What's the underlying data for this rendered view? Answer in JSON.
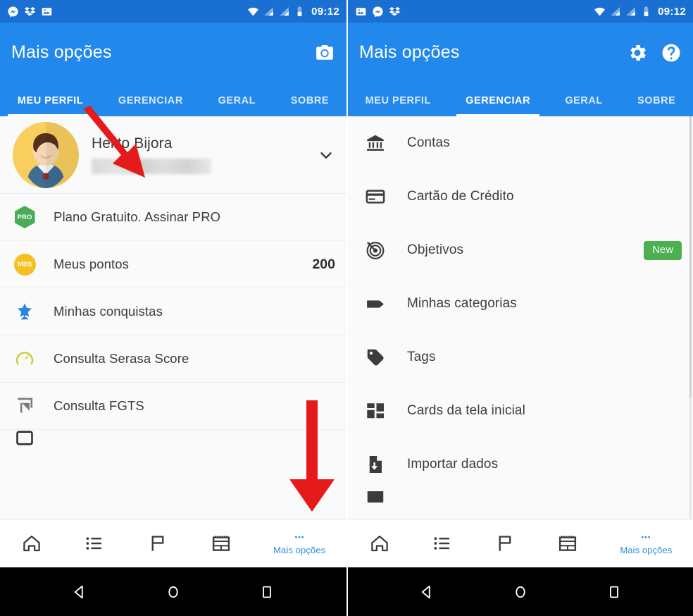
{
  "status_bar": {
    "time": "09:12",
    "left_icons_panel1": [
      "messenger-icon",
      "dropbox-icon",
      "photos-icon"
    ],
    "left_icons_panel2": [
      "photos-icon",
      "messenger-icon",
      "dropbox-icon"
    ],
    "right_icons": [
      "wifi-icon",
      "signal-icon",
      "signal-icon",
      "battery-icon"
    ]
  },
  "colors": {
    "status_bar": "#1a6fd2",
    "app_bar": "#2288ec",
    "accent": "#2a8fe0",
    "badge_new": "#4caf50",
    "pro_badge": "#47ab57",
    "points_badge": "#f5c022",
    "arrow": "#e51a1a"
  },
  "panel_left": {
    "app_bar": {
      "title": "Mais opções",
      "actions": [
        {
          "name": "camera-icon",
          "label": "Câmera"
        }
      ]
    },
    "tabs": [
      {
        "label": "MEU PERFIL",
        "active": true
      },
      {
        "label": "GERENCIAR",
        "active": false
      },
      {
        "label": "GERAL",
        "active": false
      },
      {
        "label": "SOBRE",
        "active": false
      }
    ],
    "profile": {
      "name": "Helito Bijora",
      "email_masked": "",
      "avatar": "user-avatar",
      "expand": "chevron-down-icon"
    },
    "items": [
      {
        "icon": "pro-hex-badge",
        "icon_text": "PRO",
        "label": "Plano Gratuito. Assinar PRO",
        "value": ""
      },
      {
        "icon": "mbs-circle-badge",
        "icon_text": "MB$",
        "label": "Meus pontos",
        "value": "200"
      },
      {
        "icon": "trophy-star-icon",
        "icon_text": "",
        "label": "Minhas conquistas",
        "value": ""
      },
      {
        "icon": "speedometer-icon",
        "icon_text": "",
        "label": "Consulta Serasa Score",
        "value": ""
      },
      {
        "icon": "flag-corner-icon",
        "icon_text": "",
        "label": "Consulta FGTS",
        "value": ""
      }
    ]
  },
  "panel_right": {
    "app_bar": {
      "title": "Mais opções",
      "actions": [
        {
          "name": "gear-icon",
          "label": "Configurações"
        },
        {
          "name": "help-icon",
          "label": "Ajuda"
        }
      ]
    },
    "tabs": [
      {
        "label": "MEU PERFIL",
        "active": false
      },
      {
        "label": "GERENCIAR",
        "active": true
      },
      {
        "label": "GERAL",
        "active": false
      },
      {
        "label": "SOBRE",
        "active": false
      }
    ],
    "items": [
      {
        "icon": "bank-icon",
        "label": "Contas",
        "badge": ""
      },
      {
        "icon": "credit-card-icon",
        "label": "Cartão de Crédito",
        "badge": ""
      },
      {
        "icon": "target-icon",
        "label": "Objetivos",
        "badge": "New"
      },
      {
        "icon": "category-tag-icon",
        "label": "Minhas categorias",
        "badge": ""
      },
      {
        "icon": "tag-icon",
        "label": "Tags",
        "badge": ""
      },
      {
        "icon": "cards-grid-icon",
        "label": "Cards da tela inicial",
        "badge": ""
      },
      {
        "icon": "import-file-icon",
        "label": "Importar dados",
        "badge": ""
      }
    ]
  },
  "bottom_nav": {
    "items": [
      {
        "icon": "home-icon",
        "label": "",
        "active": false
      },
      {
        "icon": "list-icon",
        "label": "",
        "active": false
      },
      {
        "icon": "flag-icon",
        "label": "",
        "active": false
      },
      {
        "icon": "calendar-icon",
        "label": "",
        "active": false
      },
      {
        "icon": "more-dots-icon",
        "label": "Mais opções",
        "active": true
      }
    ]
  },
  "android_navbar": {
    "buttons": [
      "back-triangle-icon",
      "home-circle-icon",
      "recents-square-icon"
    ]
  },
  "annotations": [
    {
      "name": "arrow-pointing-meu-perfil-tab",
      "target": "MEU PERFIL"
    },
    {
      "name": "arrow-pointing-mais-opcoes-button",
      "target": "Mais opções"
    },
    {
      "name": "arrow-pointing-gerenciar-tab",
      "target": "GERENCIAR"
    }
  ]
}
